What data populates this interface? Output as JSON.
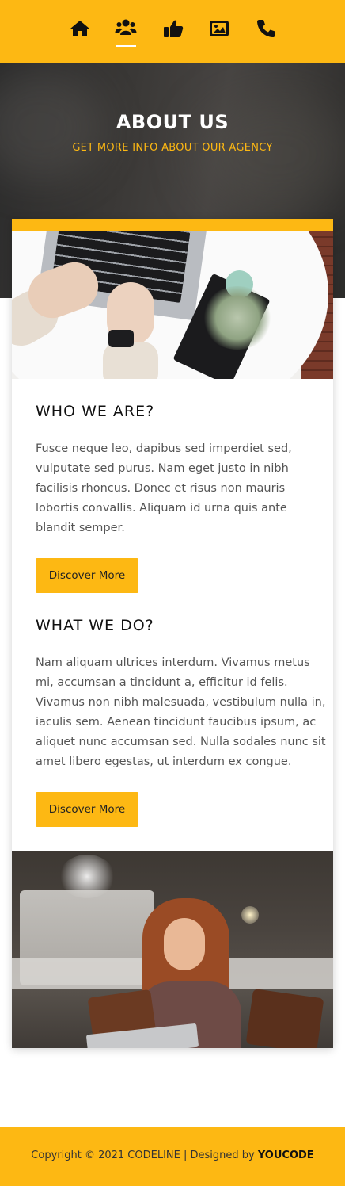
{
  "nav": {
    "items": [
      {
        "icon": "home-icon",
        "active": false
      },
      {
        "icon": "users-icon",
        "active": true
      },
      {
        "icon": "thumbs-up-icon",
        "active": false
      },
      {
        "icon": "image-icon",
        "active": false
      },
      {
        "icon": "phone-icon",
        "active": false
      }
    ]
  },
  "hero": {
    "title": "ABOUT US",
    "subtitle": "GET MORE INFO ABOUT OUR AGENCY"
  },
  "sections": [
    {
      "title": "WHO WE ARE?",
      "text": "Fusce neque leo, dapibus sed imperdiet sed, vulputate sed purus. Nam eget justo in nibh facilisis rhoncus. Donec et risus non mauris lobortis convallis. Aliquam id urna quis ante blandit semper.",
      "button": "Discover More"
    },
    {
      "title": "WHAT WE DO?",
      "text": "Nam aliquam ultrices interdum. Vivamus metus mi, accumsan a tincidunt a, efficitur id felis. Vivamus non nibh malesuada, vestibulum nulla in, iaculis sem. Aenean tincidunt faucibus ipsum, ac aliquet nunc accumsan sed. Nulla sodales nunc sit amet libero egestas, ut interdum ex congue.",
      "button": "Discover More"
    }
  ],
  "footer": {
    "text": "Copyright © 2021 CODELINE | Designed by",
    "brand": "YOUCODE"
  },
  "colors": {
    "accent": "#fdb813",
    "hero_bg": "#3a3836"
  }
}
